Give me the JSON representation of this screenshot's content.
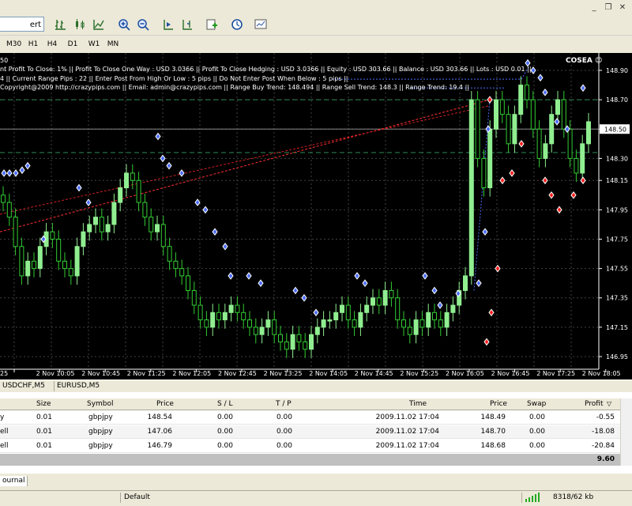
{
  "window": {
    "restore_icon": "restore-icon",
    "close_icon": "close-icon"
  },
  "toolbar": {
    "advisors_label": "ert Advisors",
    "icons": [
      "bar-chart-icon",
      "candlestick-icon",
      "line-chart-icon",
      "zoom-in-icon",
      "zoom-out-icon",
      "chart-shift-icon",
      "autoscroll-icon",
      "indicators-icon",
      "periods-icon",
      "templates-icon"
    ]
  },
  "timeframes": [
    "M30",
    "H1",
    "H4",
    "D1",
    "W1",
    "MN"
  ],
  "chart": {
    "info_lines": [
      "50",
      "nt Profit To Close: 1% || Profit To Close One Way : USD 3.0366 || Profit To Close Hedging : USD 3.0366 || Equity : USD 303.66 || Balance : USD 303.66 || Lots : USD 0.01 ||",
      "4 || Current Range Pips : 22 || Enter Post From High Or Low : 5 pips || Do Not Enter Post When Below : 5 pips ||",
      "Copyright@2009 http://crazypips.com || Email: admin@crazypips.com || Range Buy Trend: 148.494 || Range Sell Trend: 148.3 || Range Trend: 19.4 ||"
    ],
    "expert_label": "COSEA",
    "current_price": "148.50",
    "price_labels": [
      "148.90",
      "148.70",
      "148.50",
      "148.30",
      "148.15",
      "147.95",
      "147.75",
      "147.55",
      "147.35",
      "147.15",
      "146.95"
    ],
    "time_labels": [
      "25",
      "2 Nov 10:05",
      "2 Nov 10:45",
      "2 Nov 11:25",
      "2 Nov 12:05",
      "2 Nov 12:45",
      "2 Nov 13:25",
      "2 Nov 14:05",
      "2 Nov 14:45",
      "2 Nov 15:25",
      "2 Nov 16:05",
      "2 Nov 16:45",
      "2 Nov 17:25",
      "2 Nov 18:05"
    ],
    "colors": {
      "background": "#000000",
      "grid": "#404040",
      "bull": "#90ee90",
      "bear": "#32cd32",
      "buy_marker": "#4a6cf7",
      "sell_marker": "#ff2020",
      "level_line": "#2e8b57"
    }
  },
  "chart_tabs": [
    "USDCHF,M5",
    "EURUSD,M5"
  ],
  "terminal": {
    "columns": [
      "Size",
      "Symbol",
      "Price",
      "S / L",
      "T / P",
      "Time",
      "Price",
      "Swap",
      "Profit"
    ],
    "rows": [
      {
        "type": "y",
        "size": "0.01",
        "symbol": "gbpjpy",
        "price": "148.54",
        "sl": "0.00",
        "tp": "0.00",
        "time": "2009.11.02 17:04",
        "cur": "148.49",
        "swap": "0.00",
        "profit": "-0.55"
      },
      {
        "type": "ell",
        "size": "0.01",
        "symbol": "gbpjpy",
        "price": "147.06",
        "sl": "0.00",
        "tp": "0.00",
        "time": "2009.11.02 17:04",
        "cur": "148.70",
        "swap": "0.00",
        "profit": "-18.08"
      },
      {
        "type": "ell",
        "size": "0.01",
        "symbol": "gbpjpy",
        "price": "146.79",
        "sl": "0.00",
        "tp": "0.00",
        "time": "2009.11.02 17:04",
        "cur": "148.68",
        "swap": "0.00",
        "profit": "-20.84"
      }
    ],
    "total": "9.60"
  },
  "bottom_tab": "ournal",
  "status": {
    "profile": "Default",
    "traffic": "8318/62 kb"
  }
}
